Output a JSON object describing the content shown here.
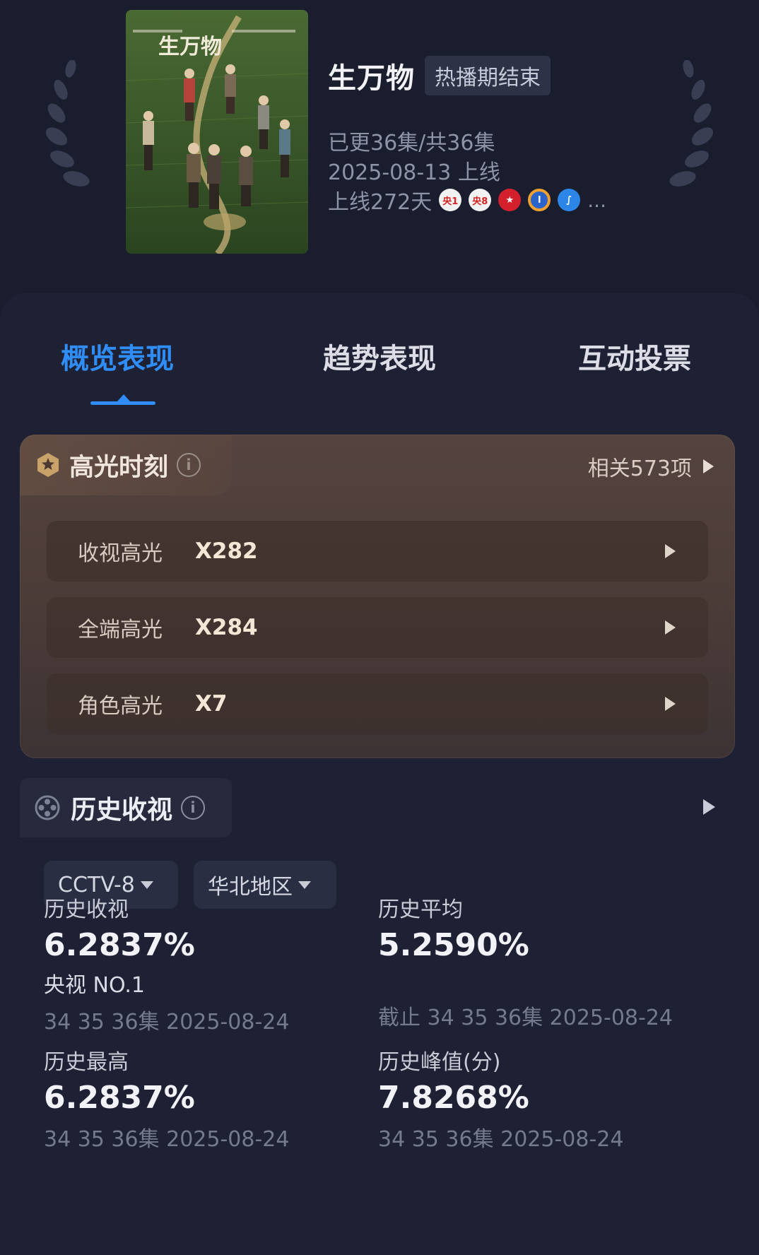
{
  "show": {
    "title": "生万物",
    "status": "热播期结束",
    "episodes": "已更36集/共36集",
    "release": "2025-08-13 上线",
    "days_online": "上线272天",
    "more": "...",
    "poster_logo_text": "生万物"
  },
  "channels": [
    {
      "icon": "cctv1-icon",
      "label": "央1"
    },
    {
      "icon": "cctv8-icon",
      "label": "央8"
    },
    {
      "icon": "dragon-tv-icon",
      "label": "★"
    },
    {
      "icon": "hunan-tv-icon",
      "label": "I"
    },
    {
      "icon": "zhejiang-tv-icon",
      "label": "∫"
    }
  ],
  "tabs": [
    {
      "label": "概览表现",
      "active": true
    },
    {
      "label": "趋势表现",
      "active": false
    },
    {
      "label": "互动投票",
      "active": false
    }
  ],
  "highlights": {
    "title": "高光时刻",
    "info": "i",
    "related": "相关573项",
    "rows": [
      {
        "label": "收视高光",
        "value": "X282"
      },
      {
        "label": "全端高光",
        "value": "X284"
      },
      {
        "label": "角色高光",
        "value": "X7"
      }
    ]
  },
  "history": {
    "title": "历史收视",
    "info": "i",
    "channel": "CCTV-8",
    "region": "华北地区",
    "stats": [
      {
        "label": "历史收视",
        "value": "6.2837%",
        "rank": "央视 NO.1",
        "sub": "34 35 36集 2025-08-24"
      },
      {
        "label": "历史平均",
        "value": "5.2590%",
        "sub": "截止 34 35 36集 2025-08-24"
      },
      {
        "label": "历史最高",
        "value": "6.2837%",
        "sub": "34 35 36集 2025-08-24"
      },
      {
        "label": "历史峰值(分)",
        "value": "7.8268%",
        "sub": "34 35 36集 2025-08-24"
      }
    ]
  },
  "colors": {
    "background": "#1a1d2e",
    "accent": "#2f8df5",
    "highlight_card": "#54433e"
  }
}
